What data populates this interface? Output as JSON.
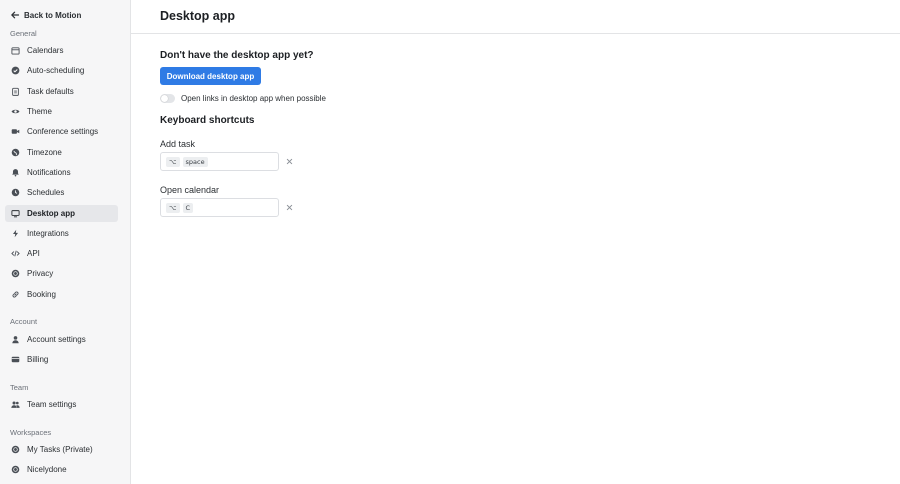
{
  "sidebar": {
    "back_label": "Back to Motion",
    "sections": {
      "general": "General",
      "account": "Account",
      "team": "Team",
      "workspaces": "Workspaces"
    },
    "general_items": [
      {
        "label": "Calendars",
        "icon": "calendar-icon"
      },
      {
        "label": "Auto-scheduling",
        "icon": "check-circle-icon"
      },
      {
        "label": "Task defaults",
        "icon": "clipboard-icon"
      },
      {
        "label": "Theme",
        "icon": "eye-icon"
      },
      {
        "label": "Conference settings",
        "icon": "video-icon"
      },
      {
        "label": "Timezone",
        "icon": "globe-icon"
      },
      {
        "label": "Notifications",
        "icon": "bell-icon"
      },
      {
        "label": "Schedules",
        "icon": "clock-icon"
      },
      {
        "label": "Desktop app",
        "icon": "monitor-icon",
        "active": true
      },
      {
        "label": "Integrations",
        "icon": "bolt-icon"
      },
      {
        "label": "API",
        "icon": "code-icon"
      },
      {
        "label": "Privacy",
        "icon": "shield-icon"
      },
      {
        "label": "Booking",
        "icon": "link-icon"
      }
    ],
    "account_items": [
      {
        "label": "Account settings",
        "icon": "user-icon"
      },
      {
        "label": "Billing",
        "icon": "credit-card-icon"
      }
    ],
    "team_items": [
      {
        "label": "Team settings",
        "icon": "users-icon"
      }
    ],
    "workspace_items": [
      {
        "label": "My Tasks (Private)",
        "icon": "workspace-icon"
      },
      {
        "label": "Nicelydone",
        "icon": "workspace-icon"
      }
    ]
  },
  "header": {
    "title": "Desktop app"
  },
  "main": {
    "heading": "Don't have the desktop app yet?",
    "download_button": "Download desktop app",
    "toggle_label": "Open links in desktop app when possible",
    "toggle_on": false,
    "shortcuts_heading": "Keyboard shortcuts",
    "shortcuts": [
      {
        "label": "Add task",
        "modifier": "⌥",
        "key": "space"
      },
      {
        "label": "Open calendar",
        "modifier": "⌥",
        "key": "C"
      }
    ]
  },
  "colors": {
    "accent": "#2f7be5",
    "sidebar_bg": "#f6f6f7",
    "active_item_bg": "#e6e7ea"
  }
}
